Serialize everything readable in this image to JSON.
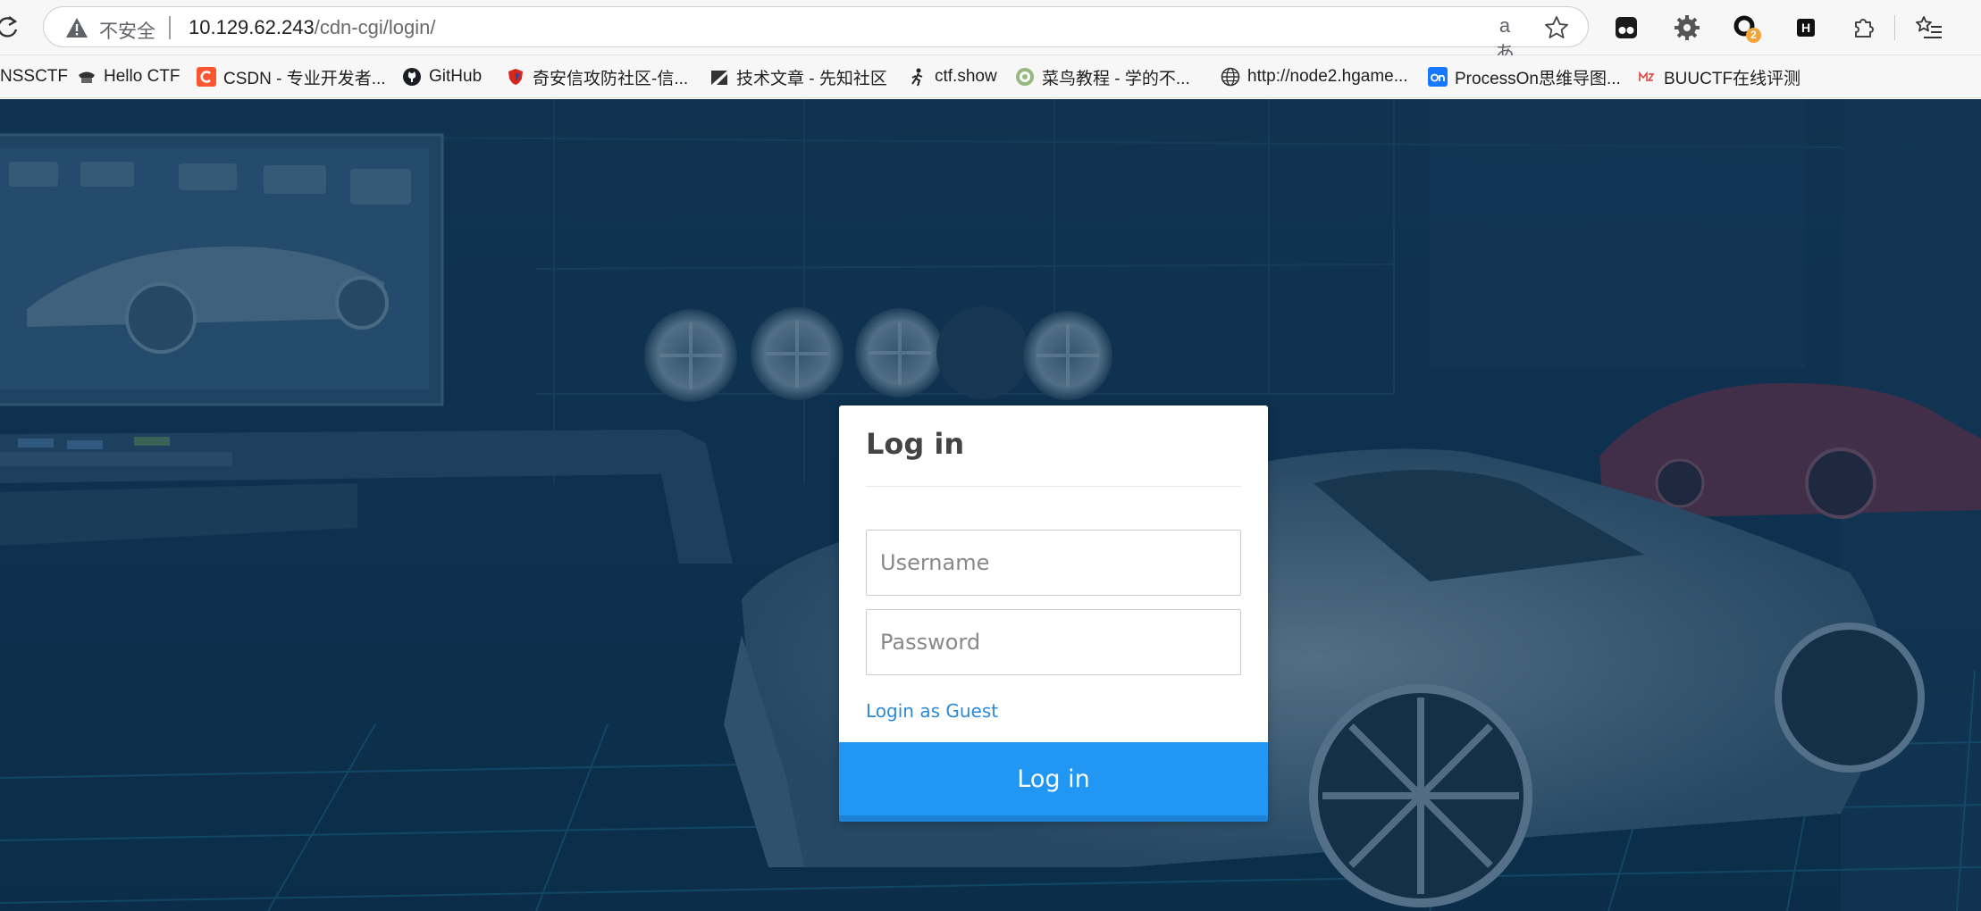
{
  "browser": {
    "insecure_label": "不安全",
    "url_host": "10.129.62.243",
    "url_path": "/cdn-cgi/login/",
    "translate_glyph": "aあ",
    "extension_badge": "2",
    "extension_h_label": "H"
  },
  "bookmarks": [
    {
      "label": "NSSCTF",
      "icon": "none"
    },
    {
      "label": "Hello CTF",
      "icon": "hello-ctf-icon"
    },
    {
      "label": "CSDN - 专业开发者...",
      "icon": "csdn-icon"
    },
    {
      "label": "GitHub",
      "icon": "github-icon"
    },
    {
      "label": "奇安信攻防社区-信...",
      "icon": "qianxin-icon"
    },
    {
      "label": "技术文章 - 先知社区",
      "icon": "xianzhi-icon"
    },
    {
      "label": "ctf.show",
      "icon": "ctfshow-icon"
    },
    {
      "label": "菜鸟教程 - 学的不...",
      "icon": "runoob-icon"
    },
    {
      "label": "http://node2.hgame...",
      "icon": "globe-icon"
    },
    {
      "label": "ProcessOn思维导图...",
      "icon": "processon-icon"
    },
    {
      "label": "BUUCTF在线评测",
      "icon": "buuctf-icon"
    }
  ],
  "login": {
    "title": "Log in",
    "username_placeholder": "Username",
    "password_placeholder": "Password",
    "guest_link": "Login as Guest",
    "submit_label": "Log in"
  },
  "colors": {
    "accent": "#2196f3",
    "link": "#2b8ad8",
    "overlay": "#0b3454"
  }
}
